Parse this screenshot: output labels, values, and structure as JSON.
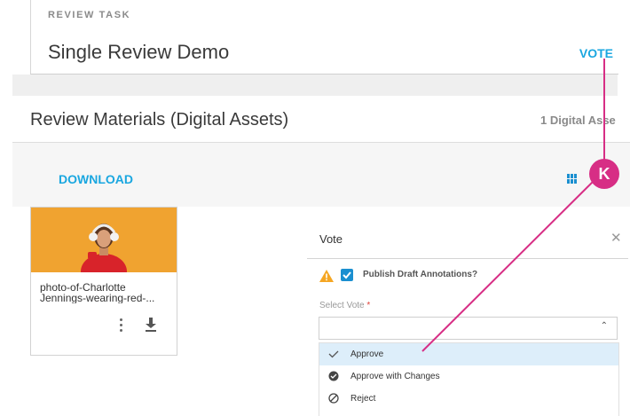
{
  "task": {
    "label": "REVIEW TASK",
    "title": "Single Review Demo",
    "vote_link": "VOTE"
  },
  "materials": {
    "title": "Review Materials (Digital Assets)",
    "count_text": "1 Digital Asse",
    "download_label": "DOWNLOAD",
    "grid_icon": "grid-view-icon",
    "assets": [
      {
        "name_line1": "photo-of-Charlotte",
        "name_line2": "Jennings-wearing-red-...",
        "more_icon": "more-vertical-icon",
        "download_icon": "download-icon"
      }
    ]
  },
  "vote_panel": {
    "title": "Vote",
    "close_icon": "close-icon",
    "warning_icon": "warning-icon",
    "publish_label": "Publish Draft Annotations?",
    "publish_checked": true,
    "select_label": "Select Vote",
    "required_mark": "*",
    "selected_value": "",
    "options": [
      {
        "label": "Approve",
        "icon": "check-icon",
        "highlighted": true
      },
      {
        "label": "Approve with Changes",
        "icon": "approve-with-changes-icon",
        "highlighted": false
      },
      {
        "label": "Reject",
        "icon": "reject-icon",
        "highlighted": false
      }
    ]
  },
  "annotation": {
    "badge_label": "K",
    "color": "#d72e85"
  },
  "colors": {
    "accent": "#1aa7e0",
    "checkbox": "#1a8fd0",
    "warning": "#f5a623",
    "thumbnail_bg": "#f0a330",
    "selected_option_bg": "#ddeefa"
  }
}
